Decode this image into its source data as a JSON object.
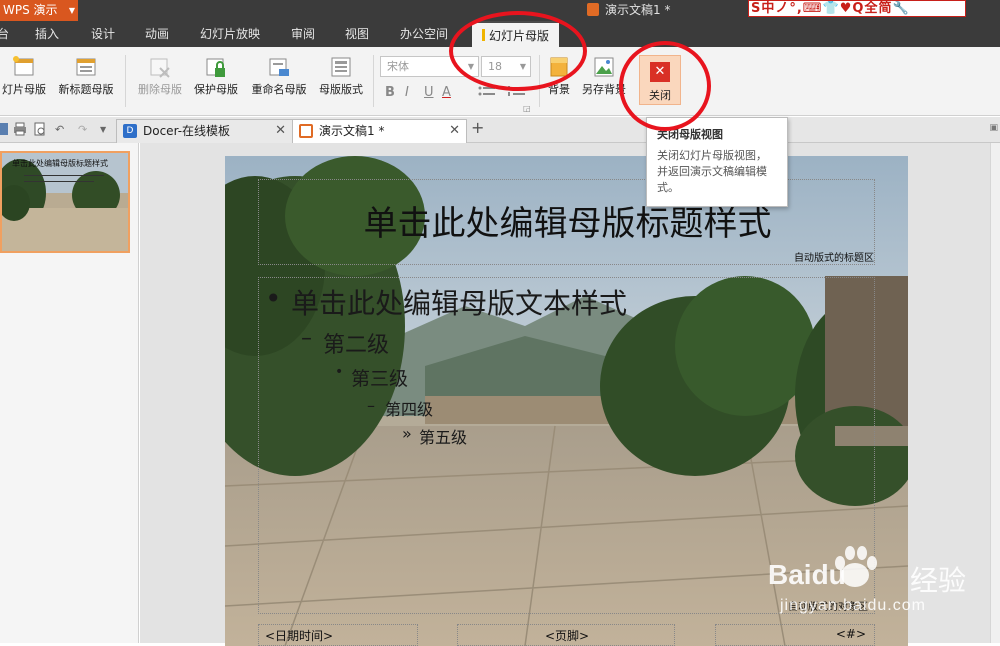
{
  "titlebar": {
    "app_name": "WPS 演示",
    "document_title": "演示文稿1 *",
    "ime_bar": "S中ノ°,⌨👕♥Q全简🔧"
  },
  "menu": {
    "tabs": [
      {
        "label": "台"
      },
      {
        "label": "插入"
      },
      {
        "label": "设计"
      },
      {
        "label": "动画"
      },
      {
        "label": "幻灯片放映"
      },
      {
        "label": "审阅"
      },
      {
        "label": "视图"
      },
      {
        "label": "办公空间"
      },
      {
        "label": "幻灯片母版",
        "active": true
      }
    ]
  },
  "ribbon": {
    "buttons": {
      "slide_master": "灯片母版",
      "new_title_master": "新标题母版",
      "delete_master": "删除母版",
      "protect_master": "保护母版",
      "rename_master": "重命名母版",
      "master_layout": "母版版式",
      "background": "背景",
      "save_background": "另存背景",
      "close": "关闭"
    },
    "font_family": "宋体",
    "font_size": "18",
    "format_buttons": [
      "B",
      "I",
      "U",
      "A"
    ]
  },
  "doc_tabs": [
    {
      "label": "Docer-在线模板",
      "active": false
    },
    {
      "label": "演示文稿1 *",
      "active": true
    }
  ],
  "tooltip": {
    "title": "关闭母版视图",
    "description": "关闭幻灯片母版视图，并返回演示文稿编辑模式。"
  },
  "slide": {
    "title": "单击此处编辑母版标题样式",
    "title_area_label": "自动版式的标题区",
    "body_levels": [
      "单击此处编辑母版文本样式",
      "第二级",
      "第三级",
      "第四级",
      "第五级"
    ],
    "bullets": [
      "•",
      "–",
      "•",
      "–",
      "»"
    ],
    "object_area_label": "自动版式的对象区",
    "footer": {
      "date": "<日期时间>",
      "footer": "<页脚>",
      "number": "<#>"
    }
  },
  "thumbnail": {
    "title": "单击此处编辑母版标题样式"
  },
  "watermark": {
    "brand": "Baidu",
    "brand_cn": "经验",
    "url": "jingyan.baidu.com"
  },
  "colors": {
    "accent": "#d9571f",
    "active_tab_mark": "#f0b400",
    "annotation": "#e8141e",
    "close_red": "#d93025"
  }
}
